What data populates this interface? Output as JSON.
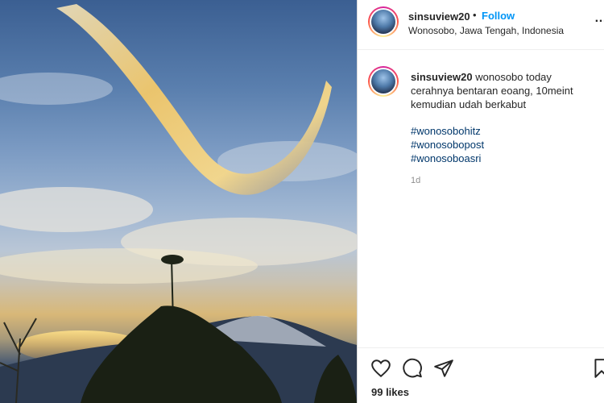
{
  "post": {
    "username": "sinsuview20",
    "separator": "•",
    "follow_label": "Follow",
    "location": "Wonosobo, Jawa Tengah, Indonesia",
    "more_icon": "more-dots-icon",
    "caption": {
      "username": "sinsuview20",
      "text": "wonosobo today cerahnya bentaran eoang, 10meint kemudian udah berkabut"
    },
    "hashtags": [
      "#wonosobohitz",
      "#wonosobopost",
      "#wonosoboasri"
    ],
    "time": "1d",
    "actions": {
      "like_icon": "heart-icon",
      "comment_icon": "comment-icon",
      "share_icon": "send-icon",
      "save_icon": "bookmark-icon"
    },
    "likes": "99 likes"
  },
  "photo": {
    "subject": "lenticular cloud over mountain at sunrise"
  },
  "colors": {
    "link": "#0095f6",
    "hashtag": "#00376b",
    "muted": "#8e8e8e",
    "text": "#262626"
  }
}
